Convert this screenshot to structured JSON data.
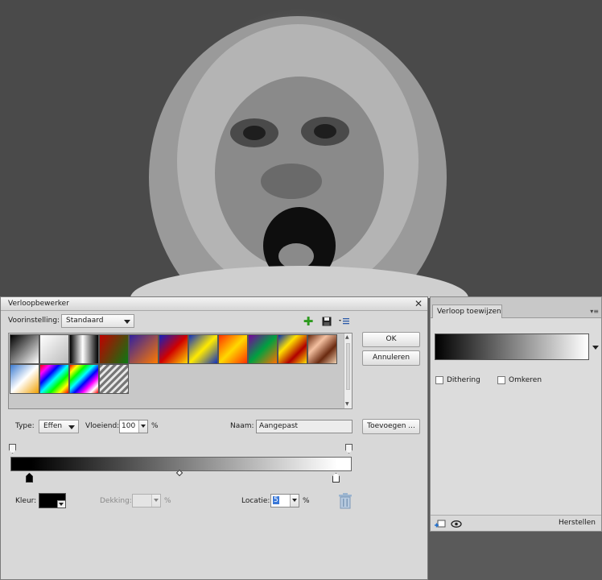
{
  "dialog": {
    "title": "Verloopbewerker",
    "preset_label": "Voorinstelling:",
    "preset_value": "Standaard",
    "ok_label": "OK",
    "cancel_label": "Annuleren",
    "type_label": "Type:",
    "type_value": "Effen",
    "smoothness_label": "Vloeiend:",
    "smoothness_value": "100",
    "smoothness_unit": "%",
    "name_label": "Naam:",
    "name_value": "Aangepast",
    "add_label": "Toevoegen ...",
    "color_label": "Kleur:",
    "opacity_label": "Dekking:",
    "opacity_unit": "%",
    "location_label": "Locatie:",
    "location_value": "5",
    "location_unit": "%",
    "icons": [
      "add-icon",
      "save-icon",
      "list-menu-icon",
      "trash-icon",
      "close-icon"
    ]
  },
  "presets": {
    "colors": {
      "p1": "linear-gradient(135deg,#000,#fff)",
      "p2": "linear-gradient(135deg,#fff,#bbb)",
      "p3": "linear-gradient(90deg,#000 0%,#fff 45%,#000 100%)",
      "p4": "linear-gradient(120deg,#c00000,#0a7a12)",
      "p5": "linear-gradient(135deg,#3020a0,#ff7a00)",
      "p6": "linear-gradient(135deg,#1020c0,#d00000,#ffd800)",
      "p7": "linear-gradient(135deg,#1030c0,#ffea00,#1030c0)",
      "p8": "linear-gradient(135deg,#ff3000,#ffd800,#ff3000)",
      "p9": "linear-gradient(135deg,#7a00a0,#00a040,#ff7000)",
      "p10": "linear-gradient(135deg,#0030b0,#ffe000,#b00000,#ffe000)",
      "p11": "linear-gradient(135deg,#6a2a10,#f4c0a0,#6a2a10,#f0d0b0)",
      "p12": "linear-gradient(135deg,#3a7ad0,#ffffff,#f0a000)",
      "p13": "linear-gradient(135deg,#ff0000,#ff00ff,#0000ff,#00ffff,#00ff00,#ffff00,#ff0000)",
      "p14": "linear-gradient(135deg,#f00,#ff0,#0f0,#0ff,#00f,#f0f,#fff,#f00)",
      "p15": "repeating-linear-gradient(135deg,#777 0px,#777 3px,#e8e8e8 3px,#e8e8e8 6px)"
    }
  },
  "panel": {
    "tab_label": "Verloop toewijzen",
    "dither_label": "Dithering",
    "reverse_label": "Omkeren",
    "reset_label": "Herstellen",
    "icons": [
      "panel-menu-icon",
      "add-layer-icon",
      "visibility-icon",
      "dropdown-arrow-icon"
    ]
  }
}
